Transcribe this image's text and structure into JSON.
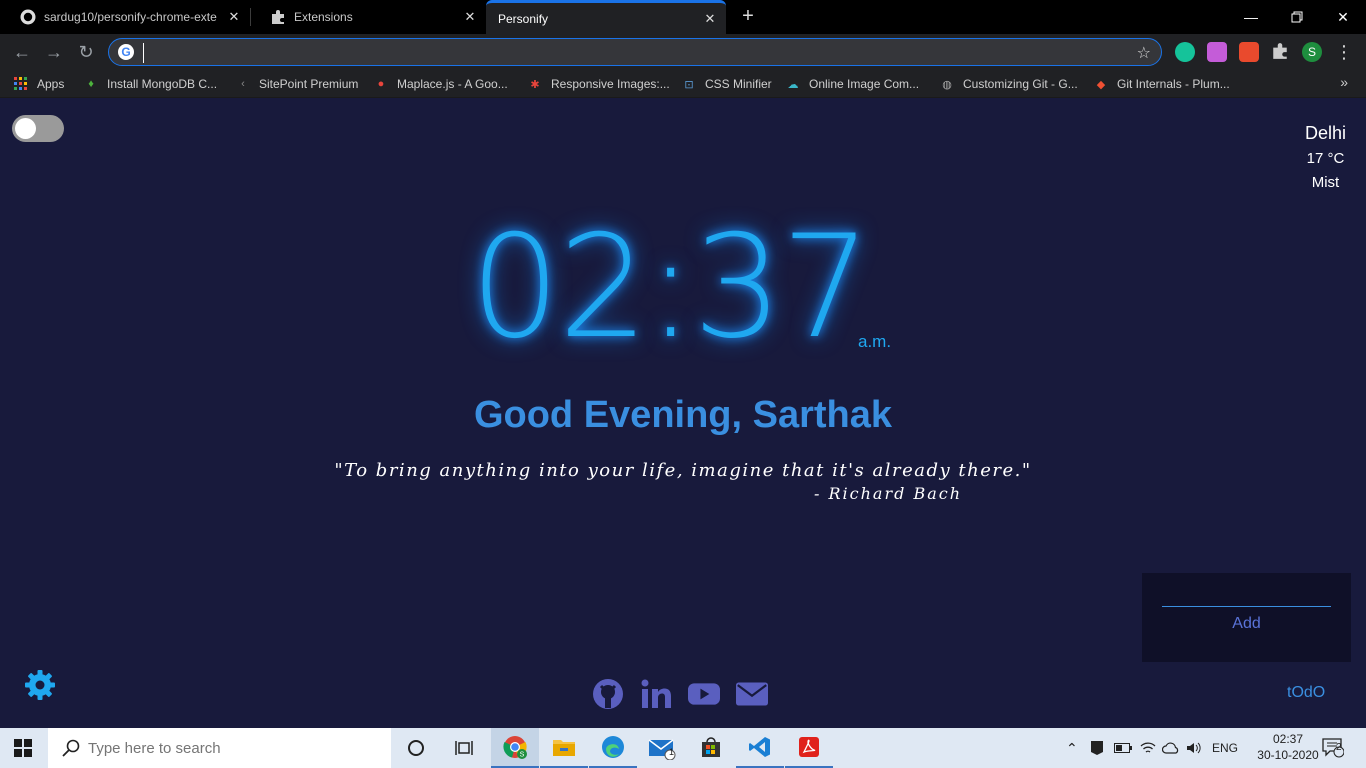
{
  "browser": {
    "tabs": [
      {
        "title": "sardug10/personify-chrome-exte",
        "icon": "github-icon"
      },
      {
        "title": "Extensions",
        "icon": "puzzle-icon"
      },
      {
        "title": "Personify",
        "icon": "none"
      }
    ],
    "address": "",
    "profile_initial": "S",
    "bookmarks": [
      {
        "label": "Apps"
      },
      {
        "label": "Install MongoDB C..."
      },
      {
        "label": "SitePoint Premium"
      },
      {
        "label": "Maplace.js - A Goo..."
      },
      {
        "label": "Responsive Images:..."
      },
      {
        "label": "CSS Minifier"
      },
      {
        "label": "Online Image Com..."
      },
      {
        "label": "Customizing Git - G..."
      },
      {
        "label": "Git Internals - Plum..."
      }
    ]
  },
  "page": {
    "weather": {
      "city": "Delhi",
      "temp": "17 °C",
      "desc": "Mist"
    },
    "clock": {
      "time": "02:37",
      "ampm": "a.m."
    },
    "greeting": "Good Evening, Sarthak",
    "quote": "\"To bring anything into your life, imagine that it's already there.\"",
    "author": "- Richard Bach",
    "todo": {
      "add_label": "Add",
      "toggle_label": "tOdO"
    },
    "colors": {
      "background": "#181a3c",
      "accent": "#1fa8f0",
      "greeting": "#3a8fe0"
    }
  },
  "taskbar": {
    "search_placeholder": "Type here to search",
    "mail_badge": "1",
    "language": "ENG",
    "time": "02:37",
    "date": "30-10-2020",
    "notifications": "2"
  }
}
